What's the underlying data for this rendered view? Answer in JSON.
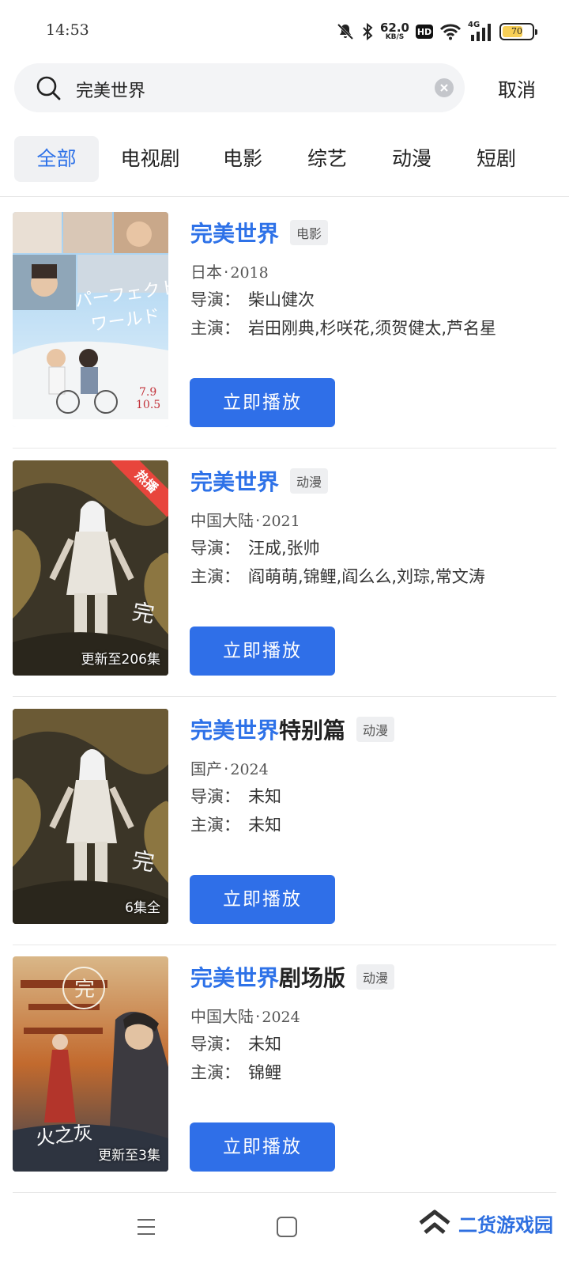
{
  "status": {
    "time": "14:53",
    "net_speed": "62.0",
    "net_unit": "KB/S",
    "hd": "HD",
    "network": "4G",
    "battery": "70",
    "battery_level": 0.7
  },
  "search": {
    "query": "完美世界",
    "cancel_label": "取消"
  },
  "tabs": [
    {
      "label": "全部",
      "active": true
    },
    {
      "label": "电视剧",
      "active": false
    },
    {
      "label": "电影",
      "active": false
    },
    {
      "label": "综艺",
      "active": false
    },
    {
      "label": "动漫",
      "active": false
    },
    {
      "label": "短剧",
      "active": false
    }
  ],
  "colors": {
    "accent": "#2e72e8",
    "button": "#2f6fe8",
    "hot_badge": "#e8453c"
  },
  "results": [
    {
      "title_highlight": "完美世界",
      "title_rest": "",
      "tag": "电影",
      "region": "日本",
      "year": "2018",
      "director_label": "导演：",
      "director": "柴山健次",
      "cast_label": "主演：",
      "cast": "岩田刚典,杉咲花,须贺健太,芦名星",
      "play_label": "立即播放",
      "poster_caption": "",
      "badge": ""
    },
    {
      "title_highlight": "完美世界",
      "title_rest": "",
      "tag": "动漫",
      "region": "中国大陆",
      "year": "2021",
      "director_label": "导演：",
      "director": "汪成,张帅",
      "cast_label": "主演：",
      "cast": "阎萌萌,锦鲤,阎么么,刘琮,常文涛",
      "play_label": "立即播放",
      "poster_caption": "更新至206集",
      "badge": "热播"
    },
    {
      "title_highlight": "完美世界",
      "title_rest": "特别篇",
      "tag": "动漫",
      "region": "国产",
      "year": "2024",
      "director_label": "导演：",
      "director": "未知",
      "cast_label": "主演：",
      "cast": "未知",
      "play_label": "立即播放",
      "poster_caption": "6集全",
      "badge": ""
    },
    {
      "title_highlight": "完美世界",
      "title_rest": "剧场版",
      "tag": "动漫",
      "region": "中国大陆",
      "year": "2024",
      "director_label": "导演：",
      "director": "未知",
      "cast_label": "主演：",
      "cast": "锦鲤",
      "play_label": "立即播放",
      "poster_caption": "更新至3集",
      "badge": ""
    }
  ],
  "watermark": "二货游戏园"
}
